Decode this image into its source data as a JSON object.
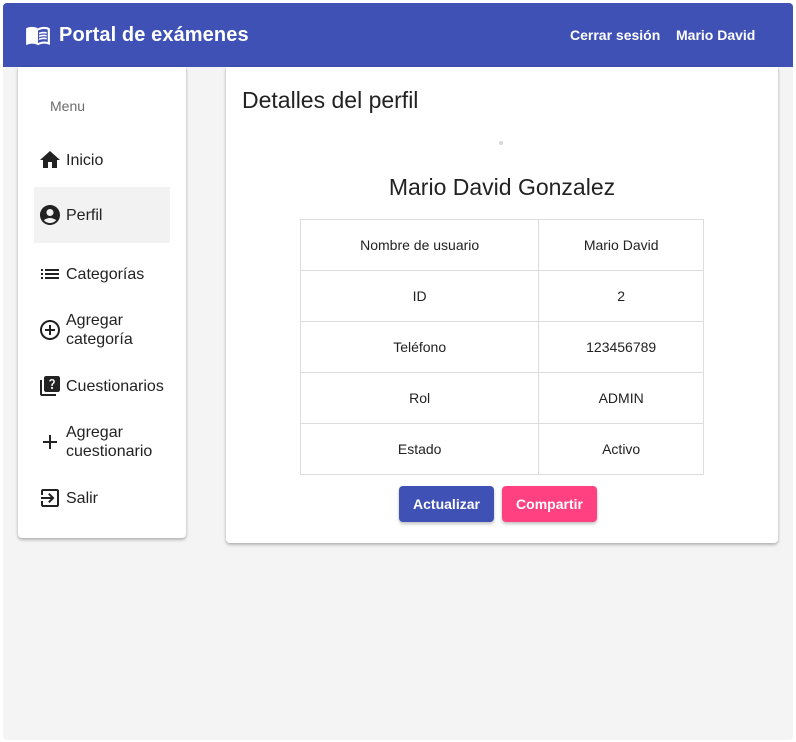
{
  "header": {
    "title": "Portal de exámenes",
    "logout_label": "Cerrar sesión",
    "user_label": "Mario David"
  },
  "sidebar": {
    "menu_header": "Menu",
    "items": [
      {
        "label": "Inicio",
        "icon": "home-icon"
      },
      {
        "label": "Perfil",
        "icon": "account-circle-icon",
        "active": true
      },
      {
        "label": "Categorías",
        "icon": "list-icon"
      },
      {
        "label": "Agregar categoría",
        "icon": "add-circle-outline-icon"
      },
      {
        "label": "Cuestionarios",
        "icon": "quiz-icon"
      },
      {
        "label": "Agregar cuestionario",
        "icon": "add-icon"
      },
      {
        "label": "Salir",
        "icon": "logout-icon"
      }
    ]
  },
  "profile": {
    "title": "Detalles del perfil",
    "full_name": "Mario David Gonzalez",
    "rows": [
      {
        "key": "Nombre de usuario",
        "value": "Mario David"
      },
      {
        "key": "ID",
        "value": "2"
      },
      {
        "key": "Teléfono",
        "value": "123456789"
      },
      {
        "key": "Rol",
        "value": "ADMIN"
      },
      {
        "key": "Estado",
        "value": "Activo"
      }
    ],
    "update_label": "Actualizar",
    "share_label": "Compartir"
  },
  "colors": {
    "primary": "#3f51b5",
    "accent": "#ff4081",
    "background": "#f4f4f4"
  }
}
